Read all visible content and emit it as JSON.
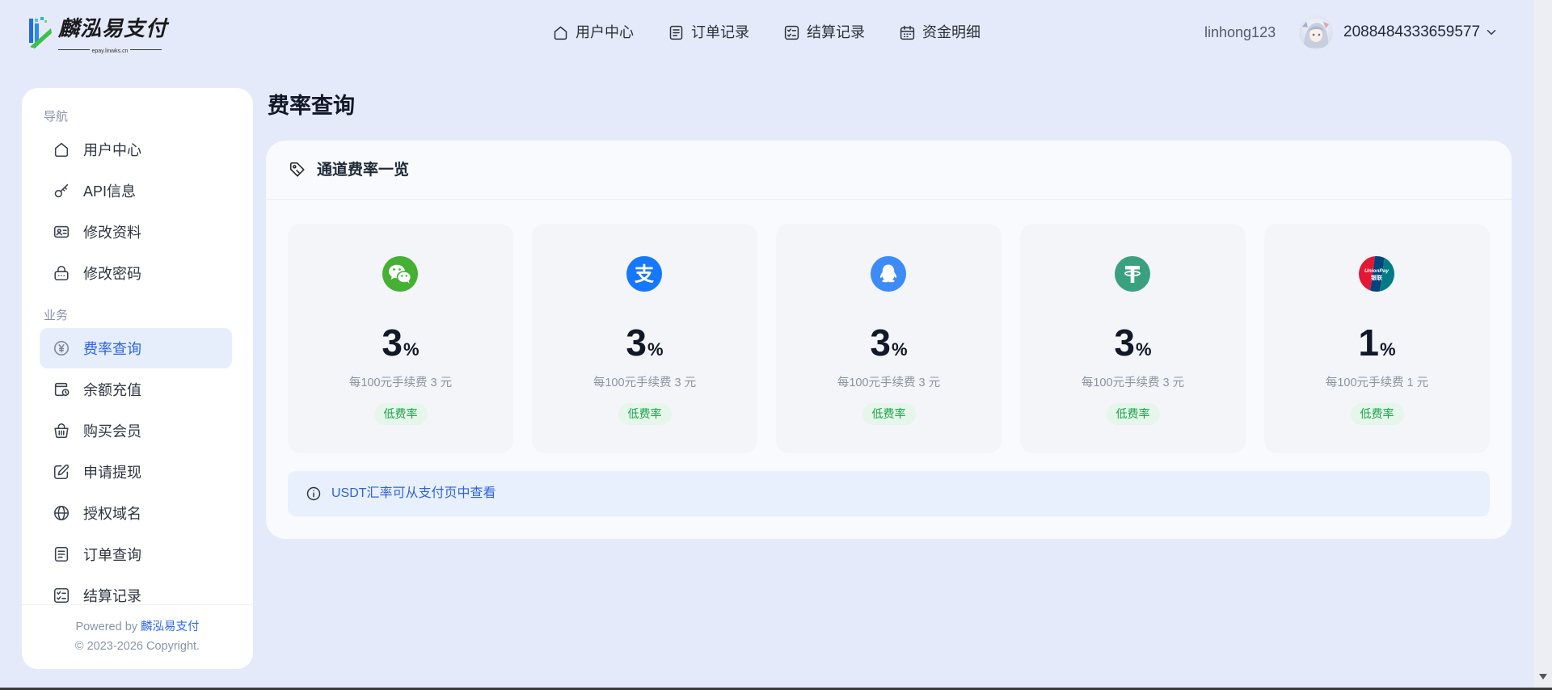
{
  "colors": {
    "page_bg": "#e5eafb",
    "accent": "#2d63e8",
    "active_bg": "#e6eefc",
    "badge_bg": "#e6f6ea",
    "badge_text": "#1ca34b",
    "notice_bg": "#e8f0fd"
  },
  "header": {
    "logo": {
      "title": "麟泓易支付",
      "subtitle": "epay.linwks.cn",
      "icon": "logo-mark"
    },
    "nav": [
      {
        "label": "用户中心",
        "icon": "home-icon"
      },
      {
        "label": "订单记录",
        "icon": "document-icon"
      },
      {
        "label": "结算记录",
        "icon": "checklist-icon"
      },
      {
        "label": "资金明细",
        "icon": "calendar-icon"
      }
    ],
    "user": {
      "username": "linhong123",
      "account_id": "2088484333659577",
      "avatar": "avatar-image",
      "menu_icon": "chevron-down-icon"
    }
  },
  "sidebar": {
    "sections": [
      {
        "title": "导航",
        "items": [
          {
            "label": "用户中心",
            "icon": "home-icon"
          },
          {
            "label": "API信息",
            "icon": "key-icon"
          },
          {
            "label": "修改资料",
            "icon": "id-card-icon"
          },
          {
            "label": "修改密码",
            "icon": "lock-icon"
          }
        ]
      },
      {
        "title": "业务",
        "items": [
          {
            "label": "费率查询",
            "icon": "yen-circle-icon",
            "active": true
          },
          {
            "label": "余额充值",
            "icon": "wallet-icon"
          },
          {
            "label": "购买会员",
            "icon": "basket-icon"
          },
          {
            "label": "申请提现",
            "icon": "edit-icon"
          },
          {
            "label": "授权域名",
            "icon": "globe-icon"
          },
          {
            "label": "订单查询",
            "icon": "document-icon"
          },
          {
            "label": "结算记录",
            "icon": "checklist-icon"
          }
        ]
      }
    ],
    "footer": {
      "powered_prefix": "Powered by",
      "powered_brand": "麟泓易支付",
      "copyright": "© 2023-2026 Copyright."
    }
  },
  "page": {
    "title": "费率查询"
  },
  "rates_card": {
    "title": "通道费率一览",
    "icon": "tag-icon",
    "channels": [
      {
        "icon": "wechat-pay-icon",
        "color": "#46b035",
        "rate": "3",
        "unit": "%",
        "description": "每100元手续费 3 元",
        "badge": "低费率"
      },
      {
        "icon": "alipay-icon",
        "color": "#1677ff",
        "logo_glyph": "支",
        "rate": "3",
        "unit": "%",
        "description": "每100元手续费 3 元",
        "badge": "低费率"
      },
      {
        "icon": "qq-pay-icon",
        "color": "#3d8cf5",
        "rate": "3",
        "unit": "%",
        "description": "每100元手续费 3 元",
        "badge": "低费率"
      },
      {
        "icon": "usdt-icon",
        "color": "#3aa17e",
        "rate": "3",
        "unit": "%",
        "description": "每100元手续费 3 元",
        "badge": "低费率"
      },
      {
        "icon": "unionpay-icon",
        "colors": [
          "#e21836",
          "#00447c",
          "#007b84"
        ],
        "logo_text": "UnionPay",
        "logo_text_cn": "银联",
        "rate": "1",
        "unit": "%",
        "description": "每100元手续费 1 元",
        "badge": "低费率"
      }
    ]
  },
  "notice": {
    "icon": "info-icon",
    "text": "USDT汇率可从支付页中查看"
  },
  "scrollbar": {
    "icon": "scroll-down-arrow-icon"
  }
}
